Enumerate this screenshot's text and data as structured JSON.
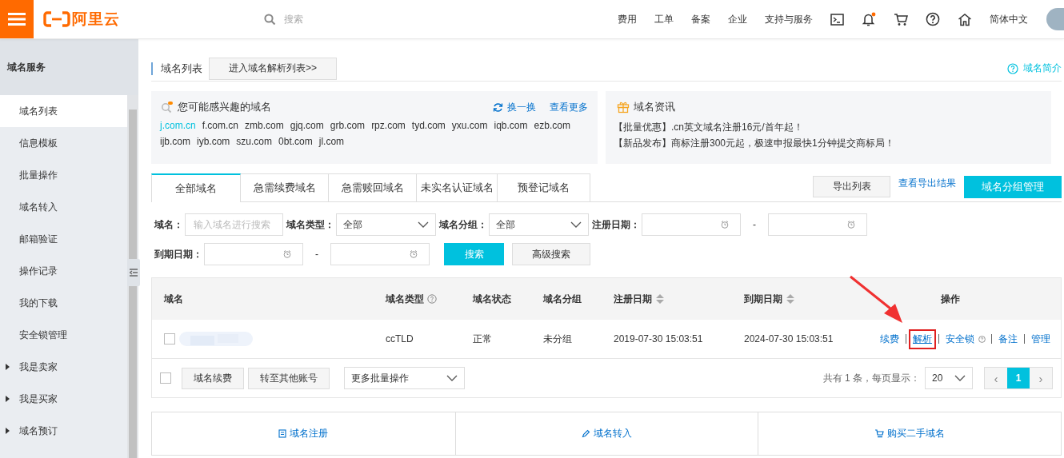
{
  "header": {
    "logo": "阿里云",
    "search_placeholder": "搜索",
    "nav": [
      "费用",
      "工单",
      "备案",
      "企业",
      "支持与服务"
    ],
    "notification_dot": true,
    "language": "简体中文"
  },
  "sidebar": {
    "title": "域名服务",
    "items": [
      {
        "label": "域名列表",
        "kind": "link",
        "selected": true
      },
      {
        "label": "信息模板",
        "kind": "link",
        "selected": false
      },
      {
        "label": "批量操作",
        "kind": "link",
        "selected": false
      },
      {
        "label": "域名转入",
        "kind": "link",
        "selected": false
      },
      {
        "label": "邮箱验证",
        "kind": "link",
        "selected": false
      },
      {
        "label": "操作记录",
        "kind": "link",
        "selected": false
      },
      {
        "label": "我的下载",
        "kind": "link",
        "selected": false
      },
      {
        "label": "安全锁管理",
        "kind": "link",
        "selected": false
      },
      {
        "label": "我是卖家",
        "kind": "group",
        "selected": false,
        "expanded": false
      },
      {
        "label": "我是买家",
        "kind": "group",
        "selected": false,
        "expanded": false
      },
      {
        "label": "域名预订",
        "kind": "group",
        "selected": false,
        "expanded": false
      }
    ]
  },
  "page": {
    "title": "域名列表",
    "dns_button": "进入域名解析列表>>",
    "help_link": "域名简介"
  },
  "suggestions": {
    "title": "您可能感兴趣的域名",
    "refresh": "换一换",
    "more": "查看更多",
    "domains": [
      {
        "name": "j.com.cn",
        "highlighted": true
      },
      {
        "name": "f.com.cn",
        "highlighted": false
      },
      {
        "name": "zmb.com",
        "highlighted": false
      },
      {
        "name": "gjq.com",
        "highlighted": false
      },
      {
        "name": "grb.com",
        "highlighted": false
      },
      {
        "name": "rpz.com",
        "highlighted": false
      },
      {
        "name": "tyd.com",
        "highlighted": false
      },
      {
        "name": "yxu.com",
        "highlighted": false
      },
      {
        "name": "iqb.com",
        "highlighted": false
      },
      {
        "name": "ezb.com",
        "highlighted": false
      },
      {
        "name": "ijb.com",
        "highlighted": false
      },
      {
        "name": "iyb.com",
        "highlighted": false
      },
      {
        "name": "szu.com",
        "highlighted": false
      },
      {
        "name": "0bt.com",
        "highlighted": false
      },
      {
        "name": "jl.com",
        "highlighted": false
      }
    ]
  },
  "news": {
    "title": "域名资讯",
    "items": [
      "【批量优惠】.cn英文域名注册16元/首年起！",
      "【新品发布】商标注册300元起，极速申报最快1分钟提交商标局！"
    ]
  },
  "tabs": [
    {
      "label": "全部域名",
      "selected": true
    },
    {
      "label": "急需续费域名",
      "selected": false
    },
    {
      "label": "急需赎回域名",
      "selected": false
    },
    {
      "label": "未实名认证域名",
      "selected": false
    },
    {
      "label": "预登记域名",
      "selected": false
    }
  ],
  "toolbar": {
    "export": "导出列表",
    "view_export": "查看导出结果",
    "group_manage": "域名分组管理"
  },
  "filters": {
    "domain_label": "域名：",
    "domain_placeholder": "输入域名进行搜索",
    "type_label": "域名类型：",
    "type_value": "全部",
    "group_label": "域名分组：",
    "group_value": "全部",
    "reg_label": "注册日期：",
    "expire_label": "到期日期：",
    "dash": "-",
    "search": "搜索",
    "advanced": "高级搜索"
  },
  "table": {
    "columns": [
      {
        "label": "域名",
        "help": false,
        "sortable": false
      },
      {
        "label": "域名类型",
        "help": true,
        "sortable": false
      },
      {
        "label": "域名状态",
        "help": false,
        "sortable": false
      },
      {
        "label": "域名分组",
        "help": false,
        "sortable": false
      },
      {
        "label": "注册日期",
        "help": false,
        "sortable": true
      },
      {
        "label": "到期日期",
        "help": false,
        "sortable": true
      },
      {
        "label": "操作",
        "help": false,
        "sortable": false
      }
    ],
    "rows": [
      {
        "checked": false,
        "type": "ccTLD",
        "status": "正常",
        "group": "未分组",
        "registered": "2019-07-30 15:03:51",
        "expires": "2024-07-30 15:03:51",
        "actions": [
          {
            "label": "续费",
            "help": false,
            "highlighted": false
          },
          {
            "label": "解析",
            "help": false,
            "highlighted": true
          },
          {
            "label": "安全锁",
            "help": true,
            "highlighted": false
          },
          {
            "label": "备注",
            "help": false,
            "highlighted": false
          },
          {
            "label": "管理",
            "help": false,
            "highlighted": false
          }
        ]
      }
    ],
    "footer": {
      "select_all_checked": false,
      "buttons": [
        "域名续费",
        "转至其他账号"
      ],
      "batch_select": "更多批量操作",
      "summary": "共有 1 条，每页显示：",
      "page_size": "20",
      "prev": "‹",
      "next": "›",
      "pages": [
        {
          "label": "1",
          "selected": true
        }
      ]
    }
  },
  "bottom_links": [
    "域名注册",
    "域名转入",
    "购买二手域名"
  ]
}
